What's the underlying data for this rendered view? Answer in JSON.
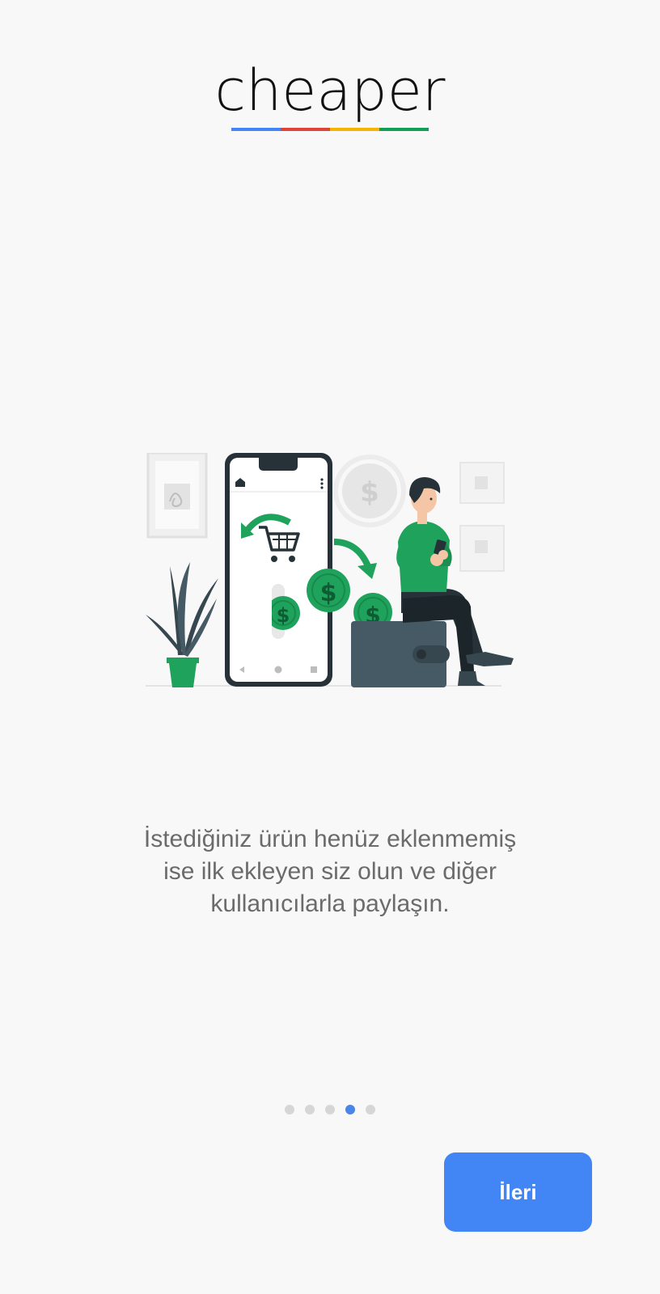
{
  "app": {
    "logo_text": "cheaper",
    "logo_bar_colors": [
      "#4285f4",
      "#db4437",
      "#f4b400",
      "#0f9d58"
    ]
  },
  "onboarding": {
    "description_lines": [
      "İstediğiniz ürün henüz eklenmemiş",
      "ise ilk ekleyen siz olun ve diğer",
      "kullanıcılarla paylaşın."
    ],
    "page_count": 5,
    "current_page": 4,
    "dot_active_color": "#4a86e8",
    "dot_inactive_color": "#d6d6d6"
  },
  "next_button": {
    "label": "İleri",
    "color": "#4285f4"
  },
  "illustration": {
    "currency_symbol": "$",
    "accent_color": "#1fa35c",
    "dark_color": "#37474f",
    "icons": [
      "home-icon",
      "more-vert-icon",
      "shopping-cart-icon",
      "back-nav-icon",
      "home-nav-icon",
      "recents-nav-icon"
    ]
  }
}
